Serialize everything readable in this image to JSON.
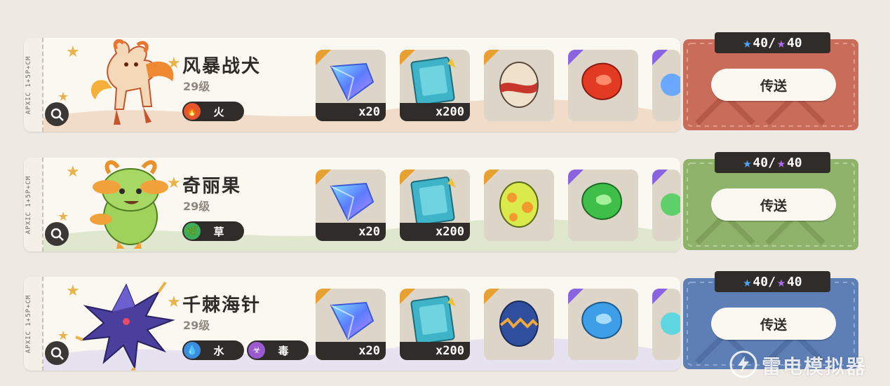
{
  "entries": [
    {
      "name": "风暴战犬",
      "level": "29级",
      "types": [
        {
          "label": "火",
          "icon": "fire-icon",
          "color": "#e4572e"
        }
      ],
      "theme_color": "#c96c5a",
      "stub_code": "APXIC 1+5P+CM",
      "items": [
        {
          "icon": "crystal-prism-icon",
          "qty": "x20"
        },
        {
          "icon": "skill-book-icon",
          "qty": "x200"
        },
        {
          "icon": "egg-red-stripe-icon",
          "qty": ""
        },
        {
          "icon": "red-gem-icon",
          "qty": ""
        }
      ],
      "counter": {
        "current": "40",
        "max": "40"
      },
      "button": "传送"
    },
    {
      "name": "奇丽果",
      "level": "29级",
      "types": [
        {
          "label": "草",
          "icon": "leaf-icon",
          "color": "#3fae5a"
        }
      ],
      "theme_color": "#8fb36a",
      "stub_code": "APXIC 1+5P+CM",
      "items": [
        {
          "icon": "crystal-prism-icon",
          "qty": "x20"
        },
        {
          "icon": "skill-book-icon",
          "qty": "x200"
        },
        {
          "icon": "egg-green-dots-icon",
          "qty": ""
        },
        {
          "icon": "green-gem-icon",
          "qty": ""
        }
      ],
      "counter": {
        "current": "40",
        "max": "40"
      },
      "button": "传送"
    },
    {
      "name": "千棘海针",
      "level": "29级",
      "types": [
        {
          "label": "水",
          "icon": "water-drop-icon",
          "color": "#3b8de0"
        },
        {
          "label": "毒",
          "icon": "poison-icon",
          "color": "#9b59d0"
        }
      ],
      "theme_color": "#5e7fb6",
      "stub_code": "APXIC 1+5P+CM",
      "items": [
        {
          "icon": "crystal-prism-icon",
          "qty": "x20"
        },
        {
          "icon": "skill-book-icon",
          "qty": "x200"
        },
        {
          "icon": "egg-blue-zigzag-icon",
          "qty": ""
        },
        {
          "icon": "blue-gem-icon",
          "qty": ""
        }
      ],
      "counter": {
        "current": "40",
        "max": "40"
      },
      "button": "传送"
    }
  ],
  "watermark": "雷电模拟器"
}
